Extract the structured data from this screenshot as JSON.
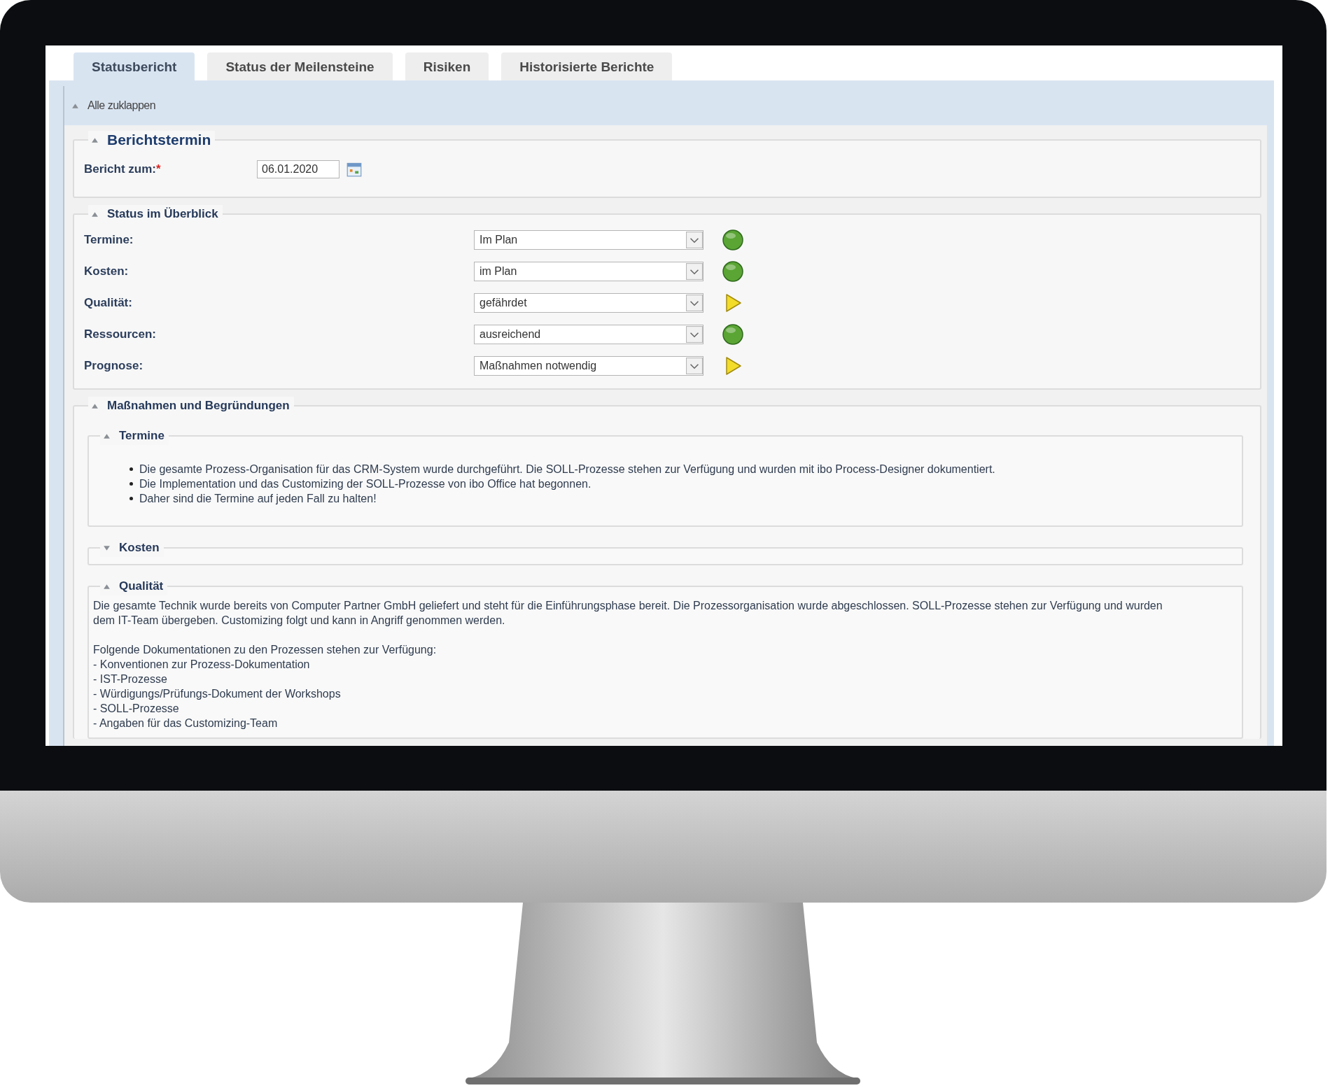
{
  "tabs": [
    {
      "label": "Statusbericht",
      "selected": true
    },
    {
      "label": "Status der Meilensteine",
      "selected": false
    },
    {
      "label": "Risiken",
      "selected": false
    },
    {
      "label": "Historisierte Berichte",
      "selected": false
    }
  ],
  "collapse_all": {
    "label": "Alle zuklappen",
    "expanded": true
  },
  "report_date": {
    "title": "Berichtstermin",
    "expanded": true,
    "label": "Bericht zum:",
    "required_mark": "*",
    "value": "06.01.2020"
  },
  "overview": {
    "title": "Status im Überblick",
    "expanded": true,
    "rows": [
      {
        "label": "Termine:",
        "value": "Im Plan",
        "kind": "light",
        "color": "#5aa534"
      },
      {
        "label": "Kosten:",
        "value": "im Plan",
        "kind": "light",
        "color": "#5aa534"
      },
      {
        "label": "Qualität:",
        "value": "gefährdet",
        "kind": "arrow",
        "color": "#f3dc2a"
      },
      {
        "label": "Ressourcen:",
        "value": "ausreichend",
        "kind": "light",
        "color": "#5aa534"
      },
      {
        "label": "Prognose:",
        "value": "Maßnahmen notwendig",
        "kind": "arrow",
        "color": "#f3dc2a"
      }
    ]
  },
  "measures": {
    "title": "Maßnahmen und Begründungen",
    "expanded": true,
    "sections": [
      {
        "title": "Termine",
        "expanded": true,
        "kind": "bullets",
        "items": [
          "Die gesamte Prozess-Organisation für das CRM-System wurde durchgeführt. Die SOLL-Prozesse stehen zur Verfügung und wurden mit ibo Process-Designer dokumentiert.",
          "Die Implementation und das Customizing der SOLL-Prozesse von ibo Office hat begonnen.",
          "Daher sind die Termine auf jeden Fall zu halten!"
        ]
      },
      {
        "title": "Kosten",
        "expanded": false
      },
      {
        "title": "Qualität",
        "expanded": true,
        "kind": "text",
        "paragraph": "Die gesamte Technik wurde bereits von Computer Partner GmbH geliefert und steht für die Einführungsphase bereit. Die Prozessorganisation wurde abgeschlossen. SOLL-Prozesse stehen zur Verfügung und wurden dem IT-Team übergeben. Customizing folgt und kann in Angriff genommen werden.",
        "lines": [
          "Folgende Dokumentationen zu den Prozessen stehen zur Verfügung:",
          "- Konventionen zur Prozess-Dokumentation",
          "- IST-Prozesse",
          "- Würdigungs/Prüfungs-Dokument der Workshops",
          "- SOLL-Prozesse",
          "- Angaben für das Customizing-Team"
        ]
      }
    ]
  }
}
